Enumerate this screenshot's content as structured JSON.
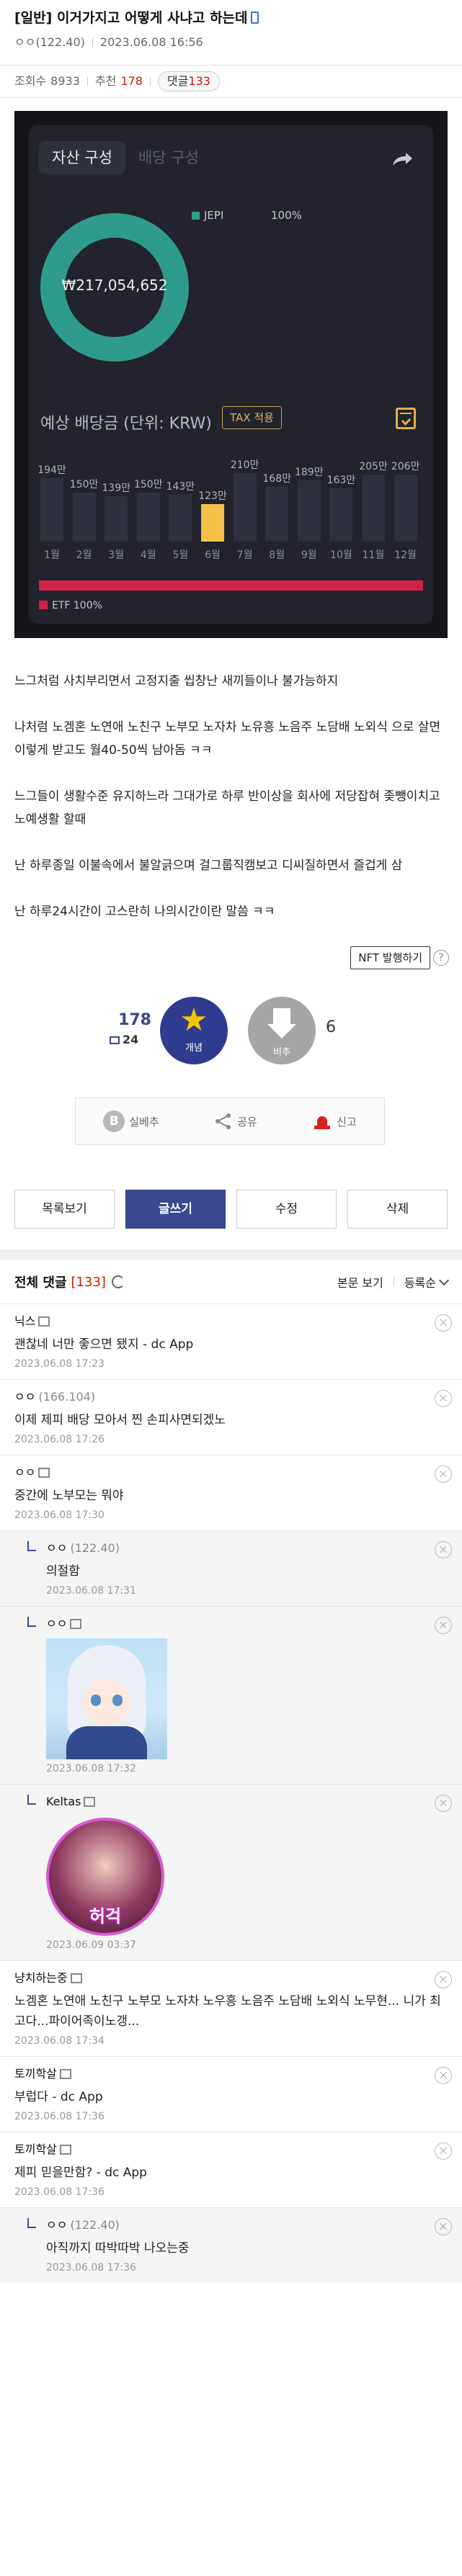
{
  "post": {
    "title": "[일반] 이거가지고 어떻게 사냐고 하는데",
    "author": "ㅇㅇ(122.40)",
    "date": "2023.06.08 16:56",
    "views_label": "조회수",
    "views": "8933",
    "recommend_label": "추천",
    "recommend": "178",
    "comment_badge_label": "댓글",
    "comment_badge_count": "133"
  },
  "app_screenshot": {
    "tab_active": "자산 구성",
    "tab_inactive": "배당 구성",
    "total_amount": "₩217,054,652",
    "legend_name": "JEPI",
    "legend_pct": "100%",
    "dividend_title": "예상 배당금 (단위: KRW)",
    "tax_button": "TAX 적용",
    "etf_label": "ETF 100%",
    "colors": {
      "donut": "#2e9c8a",
      "highlight_bar": "#f3c14a",
      "etf_bar": "#cf2346",
      "tax_border": "#c9a24a"
    }
  },
  "chart_data": {
    "type": "bar",
    "title": "예상 배당금 (단위: KRW)",
    "categories": [
      "1월",
      "2월",
      "3월",
      "4월",
      "5월",
      "6월",
      "7월",
      "8월",
      "9월",
      "10월",
      "11월",
      "12월"
    ],
    "values": [
      194,
      150,
      139,
      150,
      143,
      123,
      210,
      168,
      189,
      163,
      205,
      206
    ],
    "value_labels": [
      "194만",
      "150만",
      "139만",
      "150만",
      "143만",
      "123만",
      "210만",
      "168만",
      "189만",
      "163만",
      "205만",
      "206만"
    ],
    "highlight_index": 5
  },
  "content": {
    "paragraphs": [
      "느그처럼 사치부리면서 고정지출 씹창난 새끼들이나 불가능하지",
      "나처럼 노겜혼 노연애 노친구 노부모 노자차 노유흥 노음주 노담배 노외식 으로 살면 이렇게 받고도 월40-50씩 남아돔 ㅋㅋ",
      "느그들이 생활수준 유지하느라 그대가로 하루 반이상을 회사에 저당잡혀 좆뺑이치고 노예생활 할때",
      "난 하루종일 이불속에서 불알긁으며 걸그룹직캠보고 디씨질하면서 즐겁게 삼",
      "난 하루24시간이 고스란히 나의시간이란 말씀 ㅋㅋ"
    ]
  },
  "nft": {
    "button": "NFT 발행하기",
    "help": "?"
  },
  "votes": {
    "up_count": "178",
    "fix_count": "24",
    "up_label": "개념",
    "down_label": "비추",
    "down_count": "6"
  },
  "actions": {
    "shortcut": "실베추",
    "share": "공유",
    "report": "신고"
  },
  "buttons": {
    "list": "목록보기",
    "write": "글쓰기",
    "edit": "수정",
    "delete": "삭제"
  },
  "comments_header": {
    "title": "전체 댓글",
    "count": "[133]",
    "view_body": "본문 보기",
    "sort": "등록순"
  },
  "comments": [
    {
      "nick": "닉스",
      "ip": "",
      "body": "괜찮네 너만 좋으면 됐지 - dc App",
      "date": "2023.06.08 17:23",
      "reply": false
    },
    {
      "nick": "ㅇㅇ",
      "ip": "(166.104)",
      "body": "이제 제피 배당 모아서 찐 손피사면되겠노",
      "date": "2023.06.08 17:26",
      "reply": false
    },
    {
      "nick": "ㅇㅇ",
      "ip": "",
      "body": "중간에 노부모는 뭐야",
      "date": "2023.06.08 17:30",
      "reply": false
    },
    {
      "nick": "ㅇㅇ",
      "ip": "(122.40)",
      "body": "의절함",
      "date": "2023.06.08 17:31",
      "reply": true
    },
    {
      "nick": "ㅇㅇ",
      "ip": "",
      "body": "",
      "date": "2023.06.08 17:32",
      "reply": true,
      "image": "dccon1"
    },
    {
      "nick": "Keltas",
      "ip": "",
      "body": "",
      "date": "2023.06.09 03:37",
      "reply": true,
      "image": "dccon2",
      "image_text": "허걱"
    },
    {
      "nick": "냥치하는중",
      "ip": "",
      "body": "노겜혼 노연애 노친구 노부모 노자차 노우흥 노음주 노담배 노외식 노무현... 니가 최고다...파이어족이노갱...",
      "date": "2023.06.08 17:34",
      "reply": false
    },
    {
      "nick": "토끼학살",
      "ip": "",
      "body": "부럽다 - dc App",
      "date": "2023.06.08 17:36",
      "reply": false
    },
    {
      "nick": "토끼학살",
      "ip": "",
      "body": "제피 믿을만함? - dc App",
      "date": "2023.06.08 17:36",
      "reply": false
    },
    {
      "nick": "ㅇㅇ",
      "ip": "(122.40)",
      "body": "아직까지 따박따박 나오는중",
      "date": "2023.06.08 17:36",
      "reply": true
    }
  ]
}
